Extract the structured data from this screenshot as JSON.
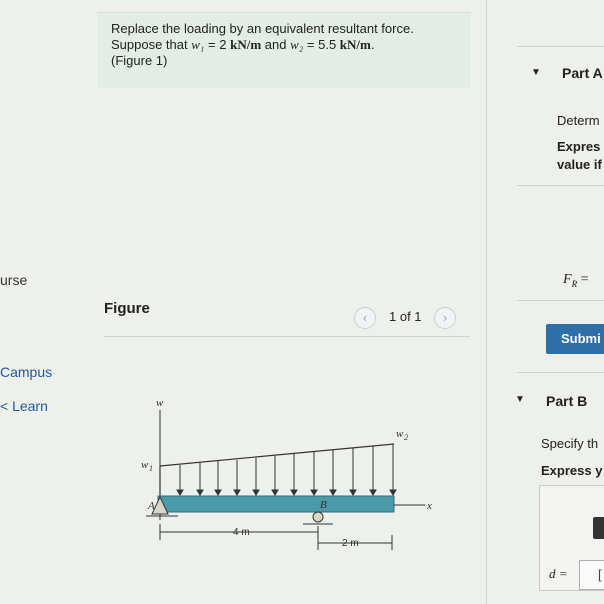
{
  "nav": {
    "course": "urse",
    "campus": "Campus",
    "learn": "< Learn"
  },
  "problem": {
    "line1": "Replace the loading by an equivalent resultant force.",
    "line2_prefix": "Suppose that ",
    "w1_sym": "w₁",
    "w1_val": " = 2 ",
    "unit1": "kN/m",
    "and": " and ",
    "w2_sym": "w₂",
    "w2_val": " = 5.5 ",
    "unit2": "kN/m",
    "period": ".",
    "figure_link": "(Figure 1)"
  },
  "figure": {
    "title": "Figure",
    "pager": "1 of 1",
    "prev_icon": "chevron-left-icon",
    "next_icon": "chevron-right-icon",
    "labels": {
      "w": "w",
      "w1": "w",
      "w1_sub": "1",
      "w2": "w",
      "w2_sub": "2",
      "A": "A",
      "B": "B",
      "x": "x",
      "dim1": "4 m",
      "dim2": "2 m"
    }
  },
  "right": {
    "partA": "Part A",
    "determine": "Determ",
    "express1": "Expres",
    "value_if": "value if",
    "fr_label": "F",
    "fr_sub": "R",
    "fr_eq": " =",
    "submit": "Submi",
    "partB": "Part B",
    "specify": "Specify th",
    "express2": "Express y",
    "d_label": "d =",
    "d_input_char": "["
  },
  "colors": {
    "accent": "#2f6fa8",
    "beam": "#4a9aa8",
    "link": "#1f5a9a"
  }
}
